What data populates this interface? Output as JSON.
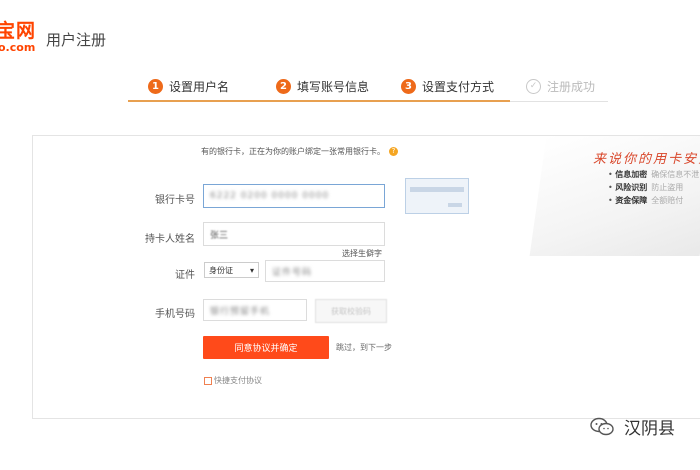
{
  "brand": {
    "logo_line1": "宝网",
    "logo_line2": "o.com",
    "accent": "#ff4400"
  },
  "page_title": "用户注册",
  "steps": [
    {
      "num": "1",
      "label": "设置用户名"
    },
    {
      "num": "2",
      "label": "填写账号信息"
    },
    {
      "num": "3",
      "label": "设置支付方式"
    },
    {
      "num": "✓",
      "label": "注册成功"
    }
  ],
  "form": {
    "tip": "有的银行卡，正在为你的账户绑定一张常用银行卡。",
    "tip_icon": "?",
    "bank_card_label": "银行卡号",
    "bank_card_value": "6222 0200 0000 0000",
    "holder_label": "持卡人姓名",
    "holder_value": "张三",
    "choose_rare_char": "选择生僻字",
    "id_label": "证件",
    "id_type": "身份证",
    "id_placeholder": "证件号码",
    "phone_label": "手机号码",
    "phone_placeholder": "银行预留手机",
    "get_code_button": "获取校验码",
    "submit_button": "同意协议并确定",
    "skip_link": "跳过，到下一步",
    "agreement_link": "快捷支付协议"
  },
  "promo": {
    "title": "来说你的用卡安全",
    "items": [
      {
        "bold": "信息加密",
        "text": "确保信息不泄"
      },
      {
        "bold": "风险识别",
        "text": "防止盗用"
      },
      {
        "bold": "资金保障",
        "text": "全额赔付"
      }
    ]
  },
  "watermark": {
    "text": "汉阴县"
  }
}
